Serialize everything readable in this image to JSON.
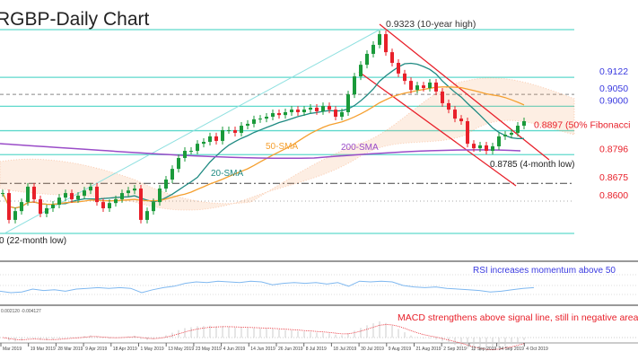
{
  "title": "RGBP-Daily Chart",
  "colors": {
    "level_line": "#5fd9cc",
    "bull_candle": "#1a9a3a",
    "bear_candle": "#e8202a",
    "sma20": "#1f8a82",
    "sma50": "#f5a030",
    "sma200": "#9a4cc8",
    "channel": "#e8202a",
    "rsi": "#7fb8f0",
    "macd_signal": "#e8202a",
    "blue_label": "#3a3ae0",
    "red_label": "#e8202a"
  },
  "chart_data": {
    "type": "candlestick",
    "title": "RGBP-Daily Chart",
    "ylim": [
      0.8445,
      0.9448
    ],
    "grid": false,
    "x_tick_labels": [
      "Mar 2019",
      "19 Mar 2019",
      "28 Mar 2019",
      "9 Apr 2019",
      "18 Apr 2019",
      "1 May 2019",
      "13 May 2019",
      "23 May 2019",
      "4 Jun 2019",
      "14 Jun 2019",
      "26 Jun 2019",
      "8 Jul 2019",
      "18 Jul 2019",
      "30 Jul 2019",
      "9 Aug 2019",
      "21 Aug 2019",
      "2 Sep 2019",
      "12 Sep 2019",
      "24 Sep 2019",
      "4 Oct 2019"
    ],
    "closes": [
      0.8634,
      0.8521,
      0.8558,
      0.8596,
      0.8661,
      0.8608,
      0.8547,
      0.857,
      0.8585,
      0.8615,
      0.8634,
      0.8608,
      0.8623,
      0.8645,
      0.8661,
      0.8596,
      0.857,
      0.8592,
      0.8608,
      0.8634,
      0.8645,
      0.8653,
      0.8521,
      0.8558,
      0.8596,
      0.8653,
      0.8691,
      0.8736,
      0.8782,
      0.8812,
      0.8812,
      0.8842,
      0.885,
      0.8873,
      0.8854,
      0.8899,
      0.8899,
      0.8888,
      0.8918,
      0.8926,
      0.8945,
      0.8948,
      0.8956,
      0.8971,
      0.8963,
      0.8975,
      0.8986,
      0.8975,
      0.8986,
      0.8994,
      0.8979,
      0.9001,
      0.8986,
      0.8956,
      0.8975,
      0.905,
      0.9126,
      0.9175,
      0.9221,
      0.9259,
      0.9304,
      0.9228,
      0.9183,
      0.9138,
      0.9107,
      0.9069,
      0.9088,
      0.9077,
      0.91,
      0.9062,
      0.9013,
      0.8986,
      0.8948,
      0.8937,
      0.8842,
      0.8823,
      0.8835,
      0.8812,
      0.8831,
      0.8873,
      0.888,
      0.8888,
      0.8918,
      0.8937
    ],
    "levels": [
      {
        "value": 0.9323,
        "label": "0.9323 (10-year high)",
        "style": "solid",
        "color": "#333333"
      },
      {
        "value": 0.9122,
        "label": "0.9122",
        "style": "solid",
        "color": "#3a3ae0"
      },
      {
        "value": 0.905,
        "label": "0.9050",
        "style": "dashed",
        "color": "#3a3ae0"
      },
      {
        "value": 0.9,
        "label": "0.9000",
        "style": "solid",
        "color": "#3a3ae0"
      },
      {
        "value": 0.8897,
        "label": "0.8897 (50% Fibonacci",
        "style": "solid",
        "color": "#e8202a"
      },
      {
        "value": 0.8796,
        "label": "0.8796",
        "style": "solid",
        "color": "#e8202a"
      },
      {
        "value": 0.8675,
        "label": "0.8675",
        "style": "dashdot",
        "color": "#e8202a"
      },
      {
        "value": 0.86,
        "label": "0.8600",
        "style": "dotted",
        "color": "#e8202a"
      }
    ],
    "annotations": {
      "low_4m": "0.8785 (4-month low)",
      "low_22m": "0 (22-month low)",
      "sma20": "20-SMA",
      "sma50": "50-SMA",
      "sma200": "200-SMA"
    },
    "rsi": {
      "label": "RSI increases momentum above 50",
      "values": [
        42,
        40,
        41,
        45,
        43,
        44,
        42,
        45,
        46,
        47,
        46,
        47,
        46,
        40,
        44,
        47,
        49,
        53,
        55,
        54,
        56,
        55,
        54,
        56,
        55,
        51,
        53,
        54,
        53,
        54,
        52,
        54,
        49,
        56,
        55,
        56,
        55,
        50,
        48,
        47,
        48,
        46,
        45,
        44,
        43,
        41,
        42,
        44,
        46,
        47
      ]
    },
    "macd": {
      "label": "MACD strengthens above signal line, still in negative area",
      "header": "0.002120 -0.004127"
    }
  }
}
